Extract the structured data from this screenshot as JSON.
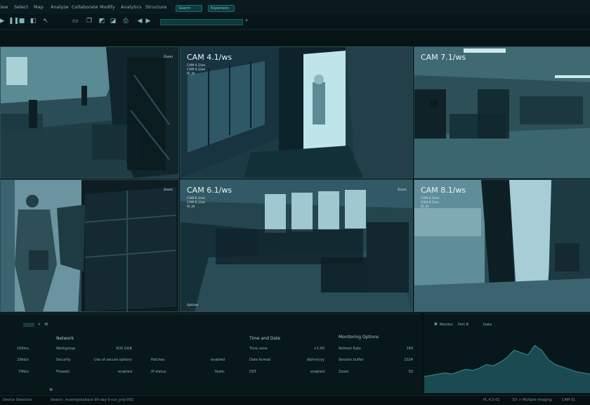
{
  "menu": {
    "items": [
      "View",
      "Select",
      "Map",
      "Analyze",
      "Collaborate",
      "Modify",
      "Analytics",
      "Structure"
    ],
    "pills": [
      "Search",
      "Expansion"
    ]
  },
  "cameras": [
    {
      "title": "",
      "meta": "",
      "tag": "Zoom",
      "foot": ""
    },
    {
      "title": "CAM 4.1/ws",
      "meta": "CAM 4.1/ws\nCAM 4.1/ws\nIR_ht",
      "tag": "",
      "foot": ""
    },
    {
      "title": "CAM 7.1/ws",
      "meta": "",
      "tag": "",
      "foot": ""
    },
    {
      "title": "",
      "meta": "",
      "tag": "Zoom",
      "foot": ""
    },
    {
      "title": "CAM 6.1/ws",
      "meta": "CAM 6.1/ws\nCAM 6.1/ws\nIR_ht",
      "tag": "Zoom",
      "foot": "Uptime"
    },
    {
      "title": "CAM 8.1/ws",
      "meta": "CAM 8.1/ws\nCAM 8.1/ws\nIR_ht",
      "tag": "",
      "foot": ""
    }
  ],
  "panel": {
    "left_values": [
      "100ms",
      "20kb/s",
      "7Mb/s"
    ],
    "network": {
      "header": "Network",
      "rows": [
        {
          "label": "Workgroup",
          "value": "SOS GGB"
        },
        {
          "label": "Security",
          "value": "Use of secure options"
        },
        {
          "label": "Firewall",
          "value": "enabled"
        }
      ],
      "extra": [
        {
          "label": "Patches",
          "value": "enabled"
        },
        {
          "label": "IP status",
          "value": "Static"
        }
      ]
    },
    "time": {
      "header": "Time and Date",
      "rows": [
        {
          "label": "Time zone",
          "value": "+1:00"
        },
        {
          "label": "Date format",
          "value": "dd/mm/yy"
        },
        {
          "label": "DST",
          "value": "enabled"
        }
      ]
    },
    "monitoring": {
      "header": "Monitoring Options",
      "rows": [
        {
          "label": "Refresh Rate",
          "value": "180"
        },
        {
          "label": "Session buffer",
          "value": "1024"
        },
        {
          "label": "Zoom",
          "value": "50"
        }
      ]
    }
  },
  "graph": {
    "tabs": [
      "Monitor",
      "Port B",
      "Data"
    ],
    "series": [
      8,
      9,
      10,
      11,
      10,
      12,
      14,
      13,
      15,
      18,
      17,
      20,
      24,
      30,
      28,
      26,
      34,
      30,
      22,
      18,
      16,
      14,
      12,
      11,
      10
    ]
  },
  "status": {
    "left": "Device Selection",
    "path": "Search: /event/playback-90-day-5-run_proj-002",
    "right": [
      "PL 4:3-01",
      "EX > Multiple Imaging",
      "CAM 01"
    ]
  },
  "colors": {
    "accent": "#1f8c92",
    "bg": "#081316"
  }
}
